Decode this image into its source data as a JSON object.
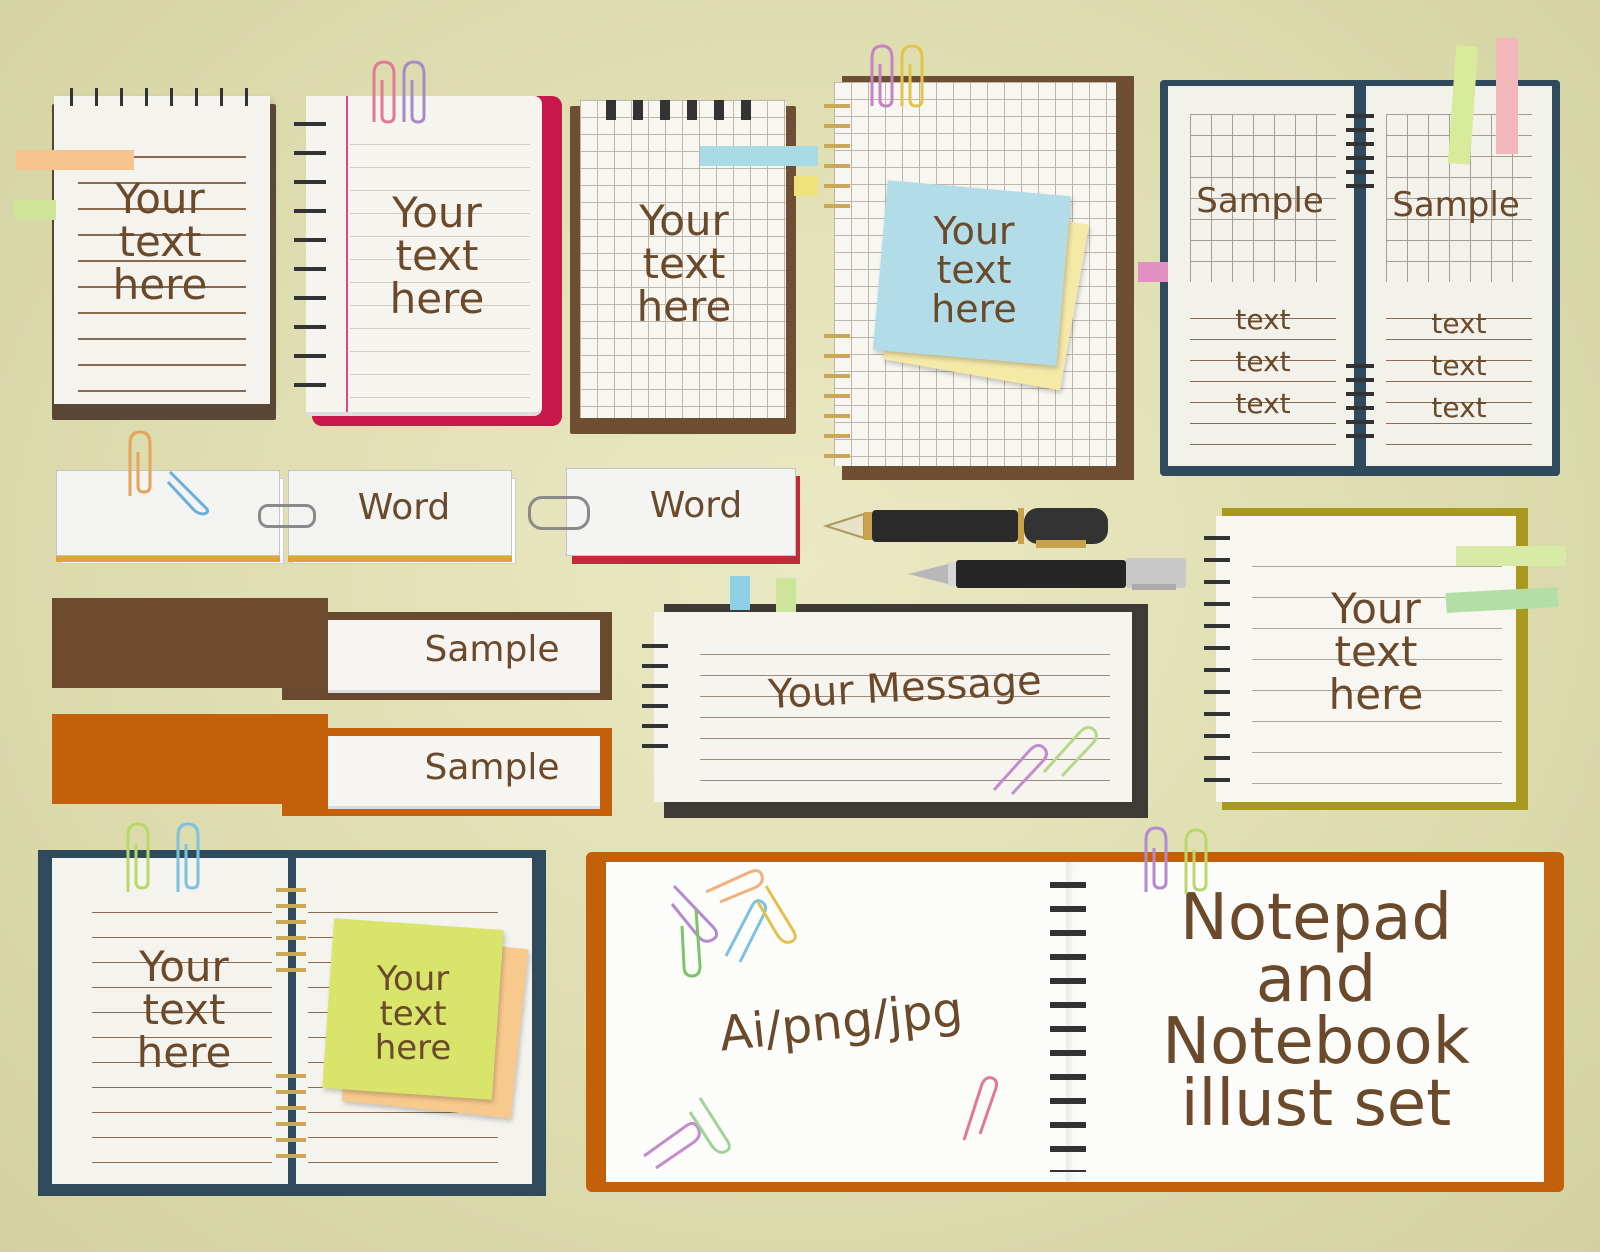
{
  "colors": {
    "background": "#dddcae",
    "text_brown": "#6b4a2b",
    "cover_dark_brown": "#5a4636",
    "cover_crimson": "#c8174b",
    "cover_navy": "#2f4a5c",
    "cover_orange": "#c5600a",
    "cover_olive": "#a89a1e"
  },
  "notepads": {
    "spiral_top_small": {
      "text": "Your\ntext\nhere"
    },
    "red_side_spiral": {
      "text": "Your\ntext\nhere"
    },
    "grid_top_spiral": {
      "text": "Your\ntext\nhere"
    },
    "grid_sticky_note": {
      "text": "Your\ntext\nhere"
    },
    "open_grid_book": {
      "left_title": "Sample",
      "right_title": "Sample",
      "left_lines": [
        "text",
        "text",
        "text"
      ],
      "right_lines": [
        "text",
        "text",
        "text"
      ]
    },
    "word_cards": [
      "Word",
      "Word"
    ],
    "index_tabs": [
      "Sample",
      "Sample"
    ],
    "message_pad": {
      "text": "Your Message"
    },
    "olive_dotted_pad": {
      "text": "Your\ntext\nhere"
    },
    "open_navy_book": {
      "left_text": "Your\ntext\nhere",
      "sticky_text": "Your\ntext\nhere"
    },
    "open_orange_book": {
      "left_text": "Ai/png/jpg",
      "title_lines": [
        "Notepad",
        "and",
        "Notebook",
        "illust set"
      ]
    }
  },
  "icons": [
    "paperclip-icon",
    "fountain-pen-icon",
    "ballpoint-pen-icon",
    "sticky-tab-icon",
    "spiral-ring-icon"
  ]
}
